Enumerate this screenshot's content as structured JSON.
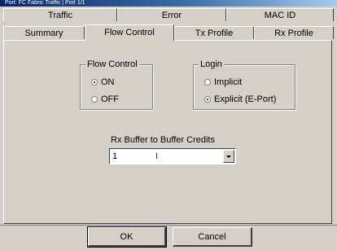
{
  "window": {
    "title": "Port: FC Fabric Traffic | Port 1/1"
  },
  "tabs": {
    "back_row": [
      {
        "label": "Traffic"
      },
      {
        "label": "Error"
      },
      {
        "label": "MAC ID"
      }
    ],
    "front_row": [
      {
        "label": "Summary",
        "active": false
      },
      {
        "label": "Flow Control",
        "active": true
      },
      {
        "label": "Tx Profile",
        "active": false
      },
      {
        "label": "Rx Profile",
        "active": false
      }
    ]
  },
  "flow_control": {
    "legend": "Flow Control",
    "options": [
      {
        "label": "ON",
        "selected": true
      },
      {
        "label": "OFF",
        "selected": false
      }
    ]
  },
  "login": {
    "legend": "Login",
    "options": [
      {
        "label": "Implicit",
        "selected": false
      },
      {
        "label": "Explicit (E-Port)",
        "selected": true
      }
    ]
  },
  "credits": {
    "label": "Rx Buffer to Buffer Credits",
    "value": "1"
  },
  "buttons": {
    "ok": "OK",
    "cancel": "Cancel"
  }
}
